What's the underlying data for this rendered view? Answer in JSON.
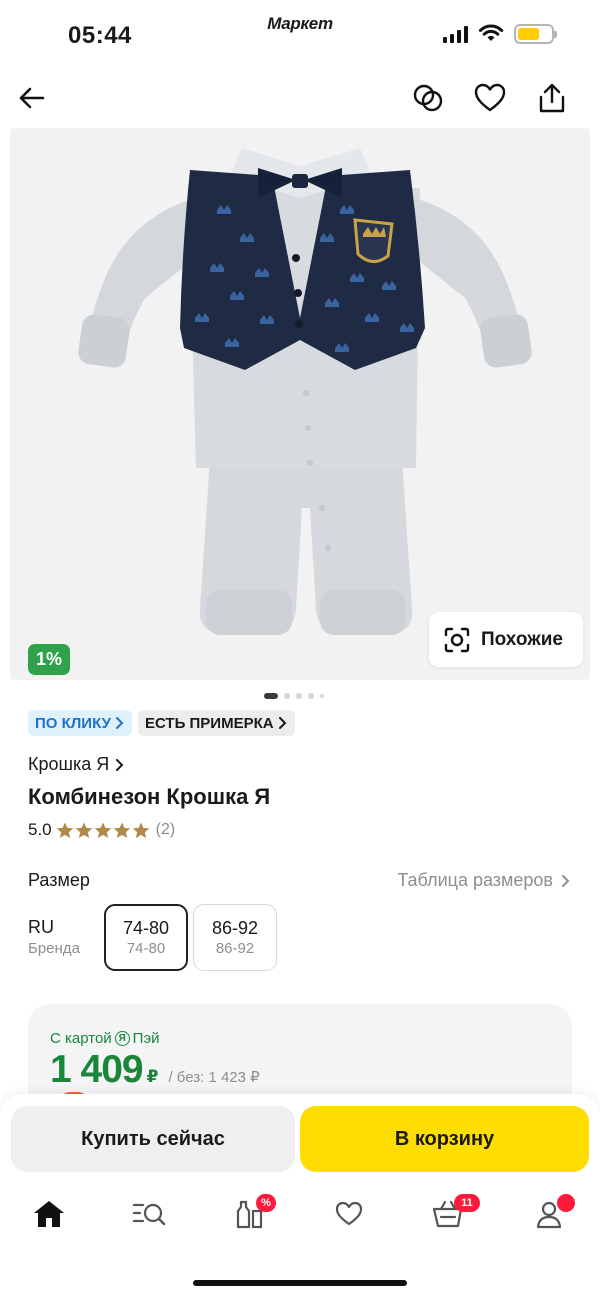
{
  "status_bar": {
    "time": "05:44",
    "app_name": "Маркет",
    "battery_color": "#ffcc00"
  },
  "top_nav": {
    "back_icon": "arrow-left-icon",
    "compare_icon": "compare-icon",
    "favorite_icon": "heart-icon",
    "share_icon": "share-icon"
  },
  "gallery": {
    "discount_badge": "1%",
    "similar_label": "Похожие",
    "similar_icon": "camera-search-icon",
    "page_count": 5,
    "active_page": 1
  },
  "chips": [
    {
      "label": "ПО КЛИКУ",
      "style": "blue"
    },
    {
      "label": "ЕСТЬ ПРИМЕРКА",
      "style": "gray"
    }
  ],
  "product": {
    "brand": "Крошка Я",
    "title": "Комбинезон Крошка Я",
    "rating": "5.0",
    "stars": 5,
    "reviews_count": "(2)",
    "star_color": "#b08a4b"
  },
  "size": {
    "label": "Размер",
    "table_link": "Таблица размеров",
    "system_main": "RU",
    "system_sub": "Бренда",
    "options": [
      {
        "main": "74-80",
        "sub": "74-80",
        "selected": true
      },
      {
        "main": "86-92",
        "sub": "86-92",
        "selected": false
      }
    ]
  },
  "price": {
    "caption_prefix": "С картой",
    "caption_mark": "Я",
    "caption_suffix": "Пэй",
    "value": "1 409",
    "currency": "₽",
    "old_price": "/ без: 1 423 ₽",
    "accent_color": "#19863a"
  },
  "actions": {
    "buy_now": "Купить сейчас",
    "add_to_cart": "В корзину",
    "cart_color": "#ffdd00"
  },
  "tabbar": {
    "items": [
      {
        "name": "home",
        "icon": "home-icon",
        "active": true
      },
      {
        "name": "catalog",
        "icon": "catalog-search-icon",
        "active": false
      },
      {
        "name": "promo",
        "icon": "bottles-discount-icon",
        "badge": "%"
      },
      {
        "name": "favorites",
        "icon": "heart-icon",
        "active": false
      },
      {
        "name": "cart",
        "icon": "cart-icon",
        "badge": "11"
      },
      {
        "name": "profile",
        "icon": "profile-icon",
        "badge_dot": true
      }
    ]
  }
}
